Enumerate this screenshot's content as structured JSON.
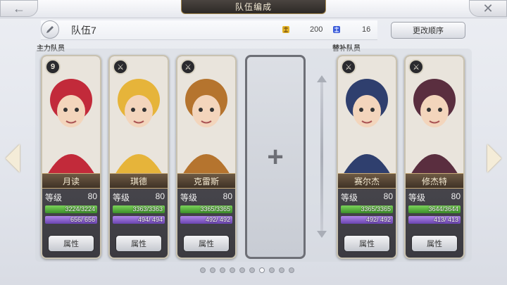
{
  "header": {
    "title": "队伍编成",
    "back_icon": "←",
    "close_icon": "✕"
  },
  "team": {
    "name": "队伍7",
    "cost_a_value": "200",
    "cost_b_value": "16",
    "reorder_label": "更改顺序"
  },
  "sections": {
    "main_label": "主力队员",
    "sub_label": "替补队员"
  },
  "level_label": "等级",
  "attr_label": "属性",
  "plus_symbol": "+",
  "cards": [
    {
      "name": "月读",
      "level": "80",
      "hp": "3224/3224",
      "mp": "656/ 656",
      "class_icon": "moon-glyph",
      "class_glyph": "9",
      "theme": "#c22a3a"
    },
    {
      "name": "琪德",
      "level": "80",
      "hp": "3363/3363",
      "mp": "494/ 494",
      "class_icon": "sword-icon",
      "class_glyph": "⚔",
      "theme": "#e6b43a"
    },
    {
      "name": "克雷斯",
      "level": "80",
      "hp": "3365/3365",
      "mp": "492/ 492",
      "class_icon": "sword-icon",
      "class_glyph": "⚔",
      "theme": "#b5742e"
    },
    {
      "name": "赛尔杰",
      "level": "80",
      "hp": "3365/3365",
      "mp": "492/ 492",
      "class_icon": "sword-icon",
      "class_glyph": "⚔",
      "theme": "#2f3f6e"
    },
    {
      "name": "修杰特",
      "level": "80",
      "hp": "3644/3644",
      "mp": "413/ 413",
      "class_icon": "sword-icon",
      "class_glyph": "⚔",
      "theme": "#5a2e3f"
    }
  ],
  "pagination": {
    "total": 10,
    "active_index": 6
  },
  "colors": {
    "hp_bar": "#5cb84a",
    "mp_bar": "#8a62d0",
    "name_plate": "#5a4836"
  }
}
